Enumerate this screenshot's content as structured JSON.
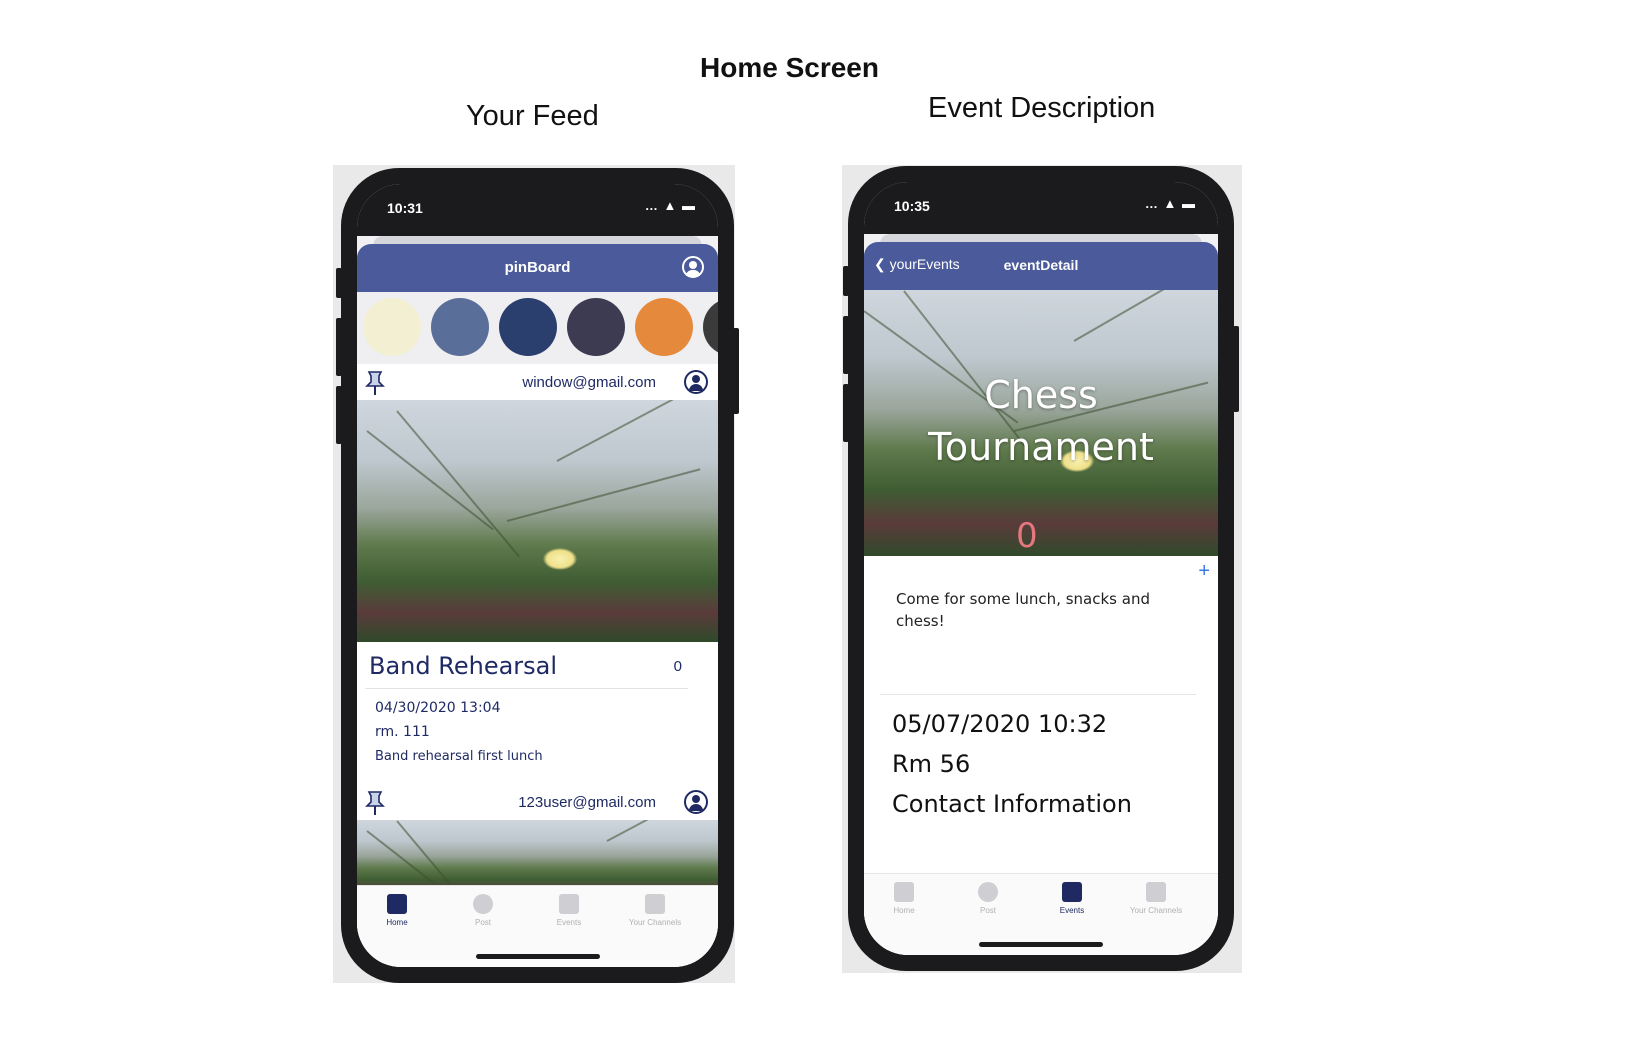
{
  "headings": {
    "main": "Home Screen",
    "feed": "Your Feed",
    "event": "Event Description"
  },
  "feed_phone": {
    "status_time": "10:31",
    "status_icons": "… ▲ ▬",
    "nav_title": "pinBoard",
    "stories": [
      "#f3efd3",
      "#5a6e9a",
      "#2b3f6e",
      "#3c3b52",
      "#e58a3c",
      "#3b3b3b"
    ],
    "posts": [
      {
        "email": "window@gmail.com"
      },
      {
        "email": "123user@gmail.com"
      }
    ],
    "card": {
      "title": "Band Rehearsal",
      "count": "0",
      "date": "04/30/2020 13:04",
      "room": "rm. 111",
      "description": "Band rehearsal first lunch"
    },
    "tabs": [
      "Home",
      "Post",
      "Events",
      "Your Channels"
    ],
    "active_tab": "Home"
  },
  "event_phone": {
    "status_time": "10:35",
    "status_icons": "… ▲ ▬",
    "back_label": "yourEvents",
    "nav_title": "eventDetail",
    "hero_title_line1": "Chess",
    "hero_title_line2": "Tournament",
    "attendee_count": "0",
    "plus": "+",
    "description": "Come for some lunch, snacks and chess!",
    "datetime": "05/07/2020 10:32",
    "room": "Rm 56",
    "contact": "Contact Information",
    "tabs": [
      "Home",
      "Post",
      "Events",
      "Your Channels"
    ],
    "active_tab": "Events"
  },
  "colors": {
    "nav": "#4a5a9a",
    "navy_text": "#1f2a63",
    "count_red": "#e5787f",
    "plus_blue": "#3b78e7"
  }
}
